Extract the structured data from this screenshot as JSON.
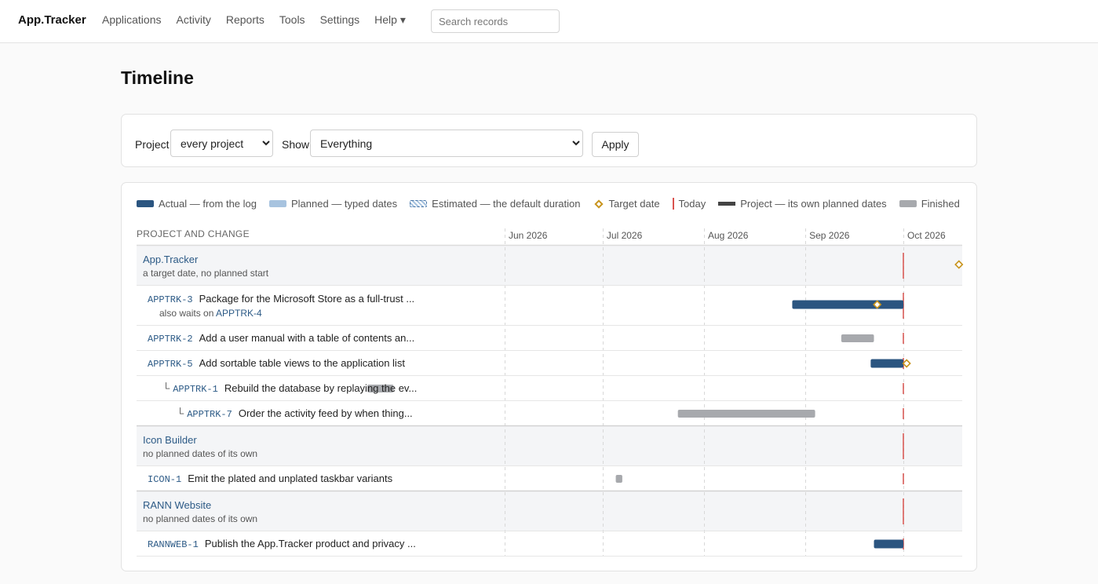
{
  "topbar": {
    "brand": "App.Tracker",
    "nav": [
      "Applications",
      "Activity",
      "Reports",
      "Tools",
      "Settings",
      "Help ▾"
    ],
    "search_placeholder": "Search records"
  },
  "page_title": "Timeline",
  "filters": {
    "project_label": "Project",
    "project_value": "every project",
    "show_label": "Show",
    "show_value": "Everything",
    "apply_label": "Apply"
  },
  "legend": {
    "actual": "Actual — from the log",
    "planned": "Planned — typed dates",
    "estimated": "Estimated — the default duration",
    "target": "Target date",
    "today": "Today",
    "project": "Project — its own planned dates",
    "finished": "Finished"
  },
  "colors": {
    "actual": "#2b5580",
    "planned": "#a7c3df",
    "finished": "#a7a9ad",
    "target": "#c8941d",
    "today": "#d9534f",
    "project": "#444444"
  },
  "timeline": {
    "column_header": "PROJECT AND CHANGE",
    "months": [
      "Jun 2026",
      "Jul 2026",
      "Aug 2026",
      "Sep 2026",
      "Oct 2026"
    ],
    "axis_start": "2026-05-01",
    "axis_end": "2026-10-31",
    "today": "2026-10-01",
    "projects": [
      {
        "name": "App.Tracker",
        "subtitle": "a target date, no planned start",
        "target": "2026-10-18",
        "changes": [
          {
            "key": "APPTRK-3",
            "title": "Package for the Microsoft Store as a full-trust ...",
            "note_prefix": "also waits on",
            "note_link": "APPTRK-4",
            "depth": 0,
            "kind": "actual",
            "start": "2026-08-28",
            "end": "2026-10-01",
            "target": "2026-09-23"
          },
          {
            "key": "APPTRK-2",
            "title": "Add a user manual with a table of contents an...",
            "depth": 0,
            "kind": "finished",
            "start": "2026-09-12",
            "end": "2026-09-22"
          },
          {
            "key": "APPTRK-5",
            "title": "Add sortable table views to the application list",
            "depth": 0,
            "kind": "actual",
            "start": "2026-09-21",
            "end": "2026-10-01",
            "target": "2026-10-02"
          },
          {
            "key": "APPTRK-1",
            "title": "Rebuild the database by replaying the ev...",
            "depth": 1,
            "kind": "finished",
            "start": "2026-04-20",
            "end": "2026-04-28"
          },
          {
            "key": "APPTRK-7",
            "title": "Order the activity feed by when thing...",
            "depth": 2,
            "kind": "finished",
            "start": "2026-07-24",
            "end": "2026-09-04"
          }
        ]
      },
      {
        "name": "Icon Builder",
        "subtitle": "no planned dates of its own",
        "changes": [
          {
            "key": "ICON-1",
            "title": "Emit the plated and unplated taskbar variants",
            "depth": 0,
            "kind": "finished",
            "start": "2026-07-05",
            "end": "2026-07-07"
          }
        ]
      },
      {
        "name": "RANN Website",
        "subtitle": "no planned dates of its own",
        "changes": [
          {
            "key": "RANNWEB-1",
            "title": "Publish the App.Tracker product and privacy ...",
            "depth": 0,
            "kind": "actual",
            "start": "2026-09-22",
            "end": "2026-10-01"
          }
        ]
      }
    ]
  }
}
